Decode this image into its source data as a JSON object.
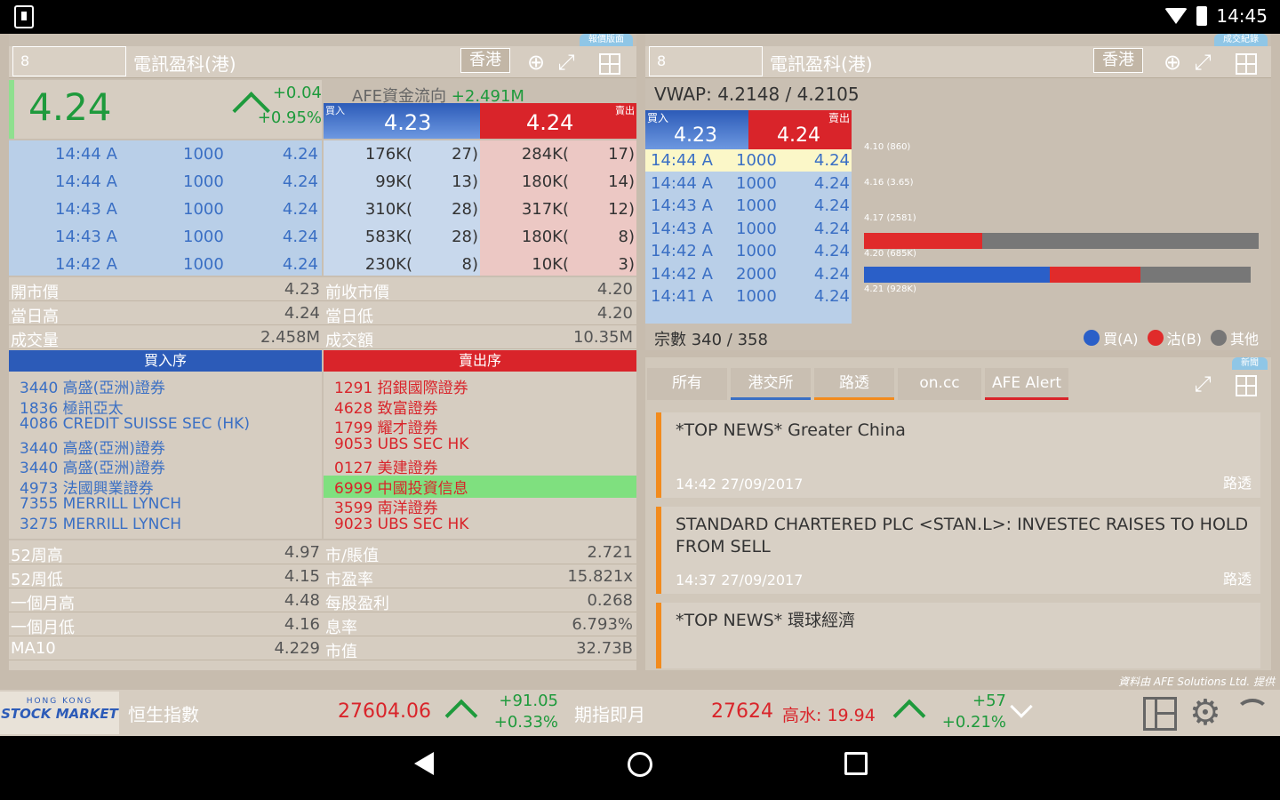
{
  "status": {
    "time": "14:45"
  },
  "left_panel": {
    "tab": "報價版面",
    "code": "8",
    "name": "電訊盈科(港)",
    "market": "香港",
    "price": "4.24",
    "change": "+0.04",
    "change_pct": "+0.95%",
    "afe_label": "AFE資金流向",
    "afe_value": "+2.491M",
    "bid_tag": "買入",
    "ask_tag": "賣出",
    "bid": "4.23",
    "ask": "4.24",
    "trades": [
      {
        "time": "14:44 A",
        "vol": "1000",
        "px": "4.24"
      },
      {
        "time": "14:44 A",
        "vol": "1000",
        "px": "4.24"
      },
      {
        "time": "14:43 A",
        "vol": "1000",
        "px": "4.24"
      },
      {
        "time": "14:43 A",
        "vol": "1000",
        "px": "4.24"
      },
      {
        "time": "14:42 A",
        "vol": "1000",
        "px": "4.24"
      }
    ],
    "bid_queue": [
      {
        "q": "176K(",
        "n": "27)"
      },
      {
        "q": "99K(",
        "n": "13)"
      },
      {
        "q": "310K(",
        "n": "28)"
      },
      {
        "q": "583K(",
        "n": "28)"
      },
      {
        "q": "230K(",
        "n": "8)"
      }
    ],
    "ask_queue": [
      {
        "q": "284K(",
        "n": "17)"
      },
      {
        "q": "180K(",
        "n": "14)"
      },
      {
        "q": "317K(",
        "n": "12)"
      },
      {
        "q": "180K(",
        "n": "8)"
      },
      {
        "q": "10K(",
        "n": "3)"
      }
    ],
    "stats1": [
      {
        "l1": "開市價",
        "v1": "4.23",
        "l2": "前收市價",
        "v2": "4.20"
      },
      {
        "l1": "當日高",
        "v1": "4.24",
        "l2": "當日低",
        "v2": "4.20"
      },
      {
        "l1": "成交量",
        "v1": "2.458M",
        "l2": "成交額",
        "v2": "10.35M"
      }
    ],
    "buy_queue_title": "買入序",
    "sell_queue_title": "賣出序",
    "buy_brokers": [
      "3440 高盛(亞洲)證券",
      "1836 極訊亞太",
      "4086 CREDIT SUISSE SEC (HK)",
      "3440 高盛(亞洲)證券",
      "3440 高盛(亞洲)證券",
      "4973 法國興業證券",
      "7355 MERRILL LYNCH",
      "3275 MERRILL LYNCH"
    ],
    "sell_brokers": [
      "1291 招銀國際證券",
      "4628 致富證券",
      "1799 耀才證券",
      "9053 UBS SEC HK",
      "0127 美建證券",
      "6999 中國投資信息",
      "3599 南洋證券",
      "9023 UBS SEC HK"
    ],
    "stats2": [
      {
        "l1": "52周高",
        "v1": "4.97",
        "l2": "市/賬值",
        "v2": "2.721"
      },
      {
        "l1": "52周低",
        "v1": "4.15",
        "l2": "市盈率",
        "v2": "15.821x"
      },
      {
        "l1": "一個月高",
        "v1": "4.48",
        "l2": "每股盈利",
        "v2": "0.268"
      },
      {
        "l1": "一個月低",
        "v1": "4.16",
        "l2": "息率",
        "v2": "6.793%"
      },
      {
        "l1": "MA10",
        "v1": "4.229",
        "l2": "市值",
        "v2": "32.73B"
      }
    ]
  },
  "right_panel": {
    "tab": "成交紀錄",
    "code": "8",
    "name": "電訊盈科(港)",
    "market": "香港",
    "vwap": "VWAP: 4.2148 / 4.2105",
    "bid_tag": "買入",
    "ask_tag": "賣出",
    "bid": "4.23",
    "ask": "4.24",
    "trades": [
      {
        "time": "14:44 A",
        "vol": "1000",
        "px": "4.24"
      },
      {
        "time": "14:44 A",
        "vol": "1000",
        "px": "4.24"
      },
      {
        "time": "14:43 A",
        "vol": "1000",
        "px": "4.24"
      },
      {
        "time": "14:43 A",
        "vol": "1000",
        "px": "4.24"
      },
      {
        "time": "14:42 A",
        "vol": "1000",
        "px": "4.24"
      },
      {
        "time": "14:42 A",
        "vol": "2000",
        "px": "4.24"
      },
      {
        "time": "14:41 A",
        "vol": "1000",
        "px": "4.24"
      }
    ],
    "bar_labels": [
      "4.10 (860)",
      "4.16 (3.65)",
      "4.17 (2581)",
      "4.20 (685K)",
      "4.21 (928K)"
    ],
    "bar1": {
      "buy": 0,
      "sell": 0.3,
      "other": 0.7
    },
    "bar2": {
      "buy": 0.47,
      "sell": 0.23,
      "other": 0.28
    },
    "deals": "宗數 340 / 358",
    "legend": [
      {
        "label": "買(A)",
        "color": "#2a5fc8"
      },
      {
        "label": "沽(B)",
        "color": "#e02b2b"
      },
      {
        "label": "其他",
        "color": "#777777"
      }
    ]
  },
  "news_panel": {
    "tab": "新聞",
    "tabs": [
      "所有",
      "港交所",
      "路透",
      "on.cc",
      "AFE Alert"
    ],
    "items": [
      {
        "title": "*TOP NEWS* Greater China",
        "meta": "14:42   27/09/2017",
        "src": "路透"
      },
      {
        "title": "STANDARD CHARTERED PLC <STAN.L>: INVESTEC RAISES TO HOLD FROM SELL",
        "meta": "14:37   27/09/2017",
        "src": "路透"
      },
      {
        "title": "*TOP NEWS*  環球經濟",
        "meta": "",
        "src": ""
      }
    ],
    "provider": "資料由 AFE Solutions Ltd. 提供"
  },
  "bottom": {
    "logo_line1": "HONG KONG",
    "logo_line2": "STOCK MARKET",
    "index_name": "恒生指數",
    "index_value": "27604.06",
    "index_chg": "+91.05",
    "index_pct": "+0.33%",
    "fut_name": "期指即月",
    "fut_value": "27624",
    "fut_extra": "高水: 19.94",
    "fut_chg": "+57",
    "fut_pct": "+0.21%"
  }
}
